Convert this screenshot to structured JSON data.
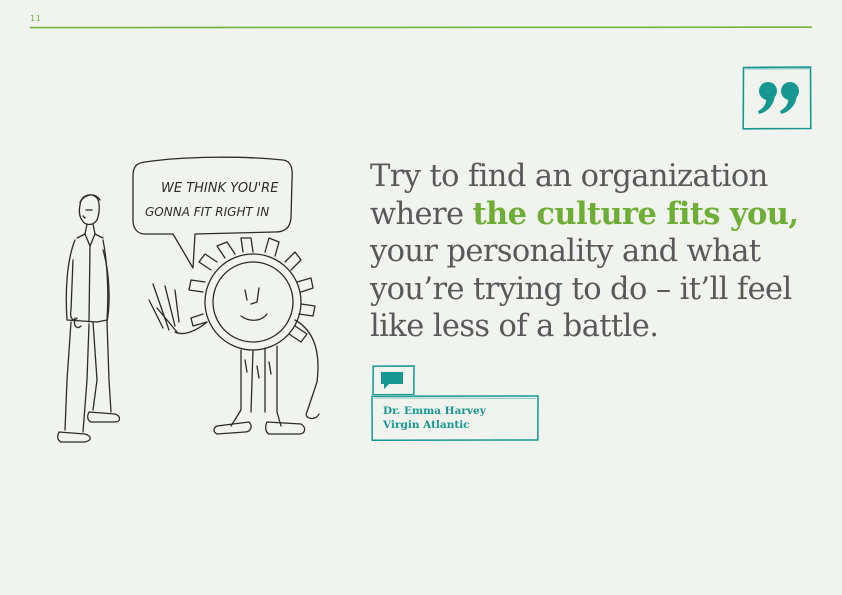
{
  "page": {
    "number": "11"
  },
  "illustration": {
    "speech_bubble_line1": "WE THINK YOU'RE",
    "speech_bubble_line2": "GONNA FIT RIGHT IN"
  },
  "quote": {
    "before": "Try to find an organization where ",
    "highlight": "the culture fits you,",
    "after": " your personality and what you’re trying to do – it’ll feel like less of a battle."
  },
  "attribution": {
    "name": "Dr. Emma Harvey",
    "organization": "Virgin Atlantic"
  },
  "colors": {
    "accent_green": "#6fae36",
    "accent_teal": "#17978f",
    "body_text": "#59595b",
    "background": "#f1f3ef"
  },
  "icons": {
    "quote": "closing-quote-icon",
    "speech": "speech-bubble-icon"
  }
}
